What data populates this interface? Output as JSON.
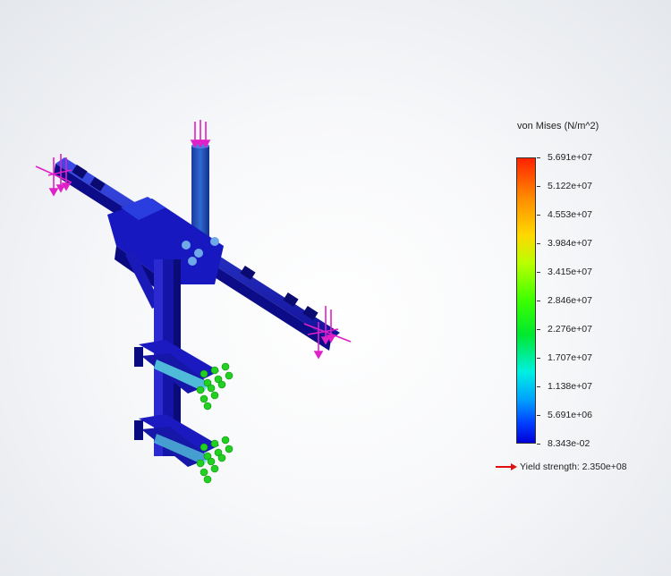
{
  "legend": {
    "title": "von Mises (N/m^2)",
    "ticks": [
      "5.691e+07",
      "5.122e+07",
      "4.553e+07",
      "3.984e+07",
      "3.415e+07",
      "2.846e+07",
      "2.276e+07",
      "1.707e+07",
      "1.138e+07",
      "5.691e+06",
      "8.343e-02"
    ],
    "colors": {
      "max": "#ff2200",
      "mid": "#3cff00",
      "min": "#0000d8"
    }
  },
  "yield": {
    "label": "Yield strength: 2.350e+08",
    "arrow_color": "#e01010"
  },
  "model": {
    "frame_color": "#1a1ad0",
    "dark_color": "#0a0a90",
    "highlight_color": "#3a6ad8",
    "load_arrow_color": "#e020c8",
    "fixture_color": "#22d022",
    "stress_low_color": "#5ad8e0",
    "icons": [
      "force-arrow-icon",
      "fixture-icon"
    ]
  }
}
